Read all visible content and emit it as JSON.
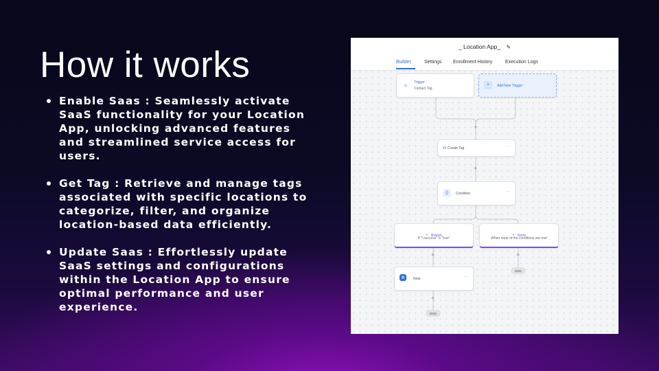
{
  "slide": {
    "title": "How it works",
    "bullets": [
      {
        "text": "Enable Saas : Seamlessly activate\nSaaS functionality for your Location\nApp, unlocking advanced features\nand streamlined service access for\nusers."
      },
      {
        "text": "Get Tag : Retrieve and manage tags\nassociated with specific locations to\ncategorize, filter, and organize\nlocation-based data efficiently."
      },
      {
        "text": " Update Saas : Effortlessly update\nSaaS settings and configurations\nwithin the Location App to ensure\noptimal performance and user\nexperience."
      }
    ]
  },
  "screenshot": {
    "app_title": "_ Location App_",
    "edit_icon": "pencil-icon",
    "tabs": [
      "Builder",
      "Settings",
      "Enrollment History",
      "Execution Logs"
    ],
    "active_tab": "Builder",
    "accent_color": "#2f6fe0",
    "trigger": {
      "title": "Trigger",
      "subtitle": "Contact Tag",
      "icon": "tag-icon"
    },
    "add_trigger": {
      "label": "Add New Trigger",
      "icon": "plus-icon"
    },
    "create_tag": {
      "label": "#1 Create Tag",
      "menu": "···"
    },
    "condition": {
      "label": "Condition",
      "icon": "braces-icon",
      "menu": "···"
    },
    "branch": {
      "title": "Branch",
      "subtitle": "If \"!.success\" is \"true\"",
      "icon": "branch-icon"
    },
    "none_branch": {
      "title": "None",
      "subtitle": "When none of the conditions are met",
      "icon": "branch-icon"
    },
    "note": {
      "label": "Note",
      "icon": "note-icon",
      "menu": "···"
    },
    "plus_symbol": "+",
    "end_label": "END"
  }
}
